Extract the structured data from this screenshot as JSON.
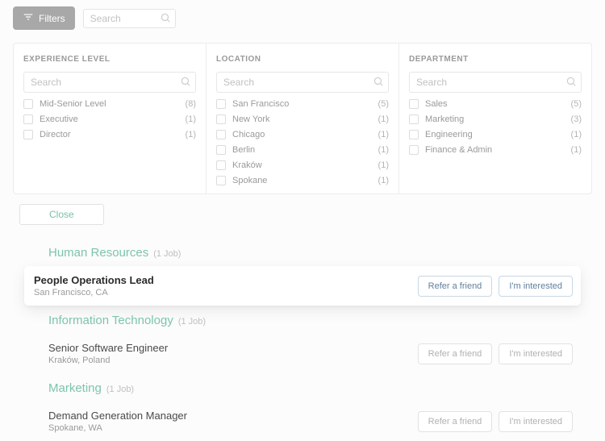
{
  "topbar": {
    "filters_label": "Filters",
    "search_placeholder": "Search"
  },
  "facets": [
    {
      "heading": "EXPERIENCE LEVEL",
      "search_placeholder": "Search",
      "options": [
        {
          "label": "Mid-Senior Level",
          "count": "(8)"
        },
        {
          "label": "Executive",
          "count": "(1)"
        },
        {
          "label": "Director",
          "count": "(1)"
        }
      ]
    },
    {
      "heading": "LOCATION",
      "search_placeholder": "Search",
      "options": [
        {
          "label": "San Francisco",
          "count": "(5)"
        },
        {
          "label": "New York",
          "count": "(1)"
        },
        {
          "label": "Chicago",
          "count": "(1)"
        },
        {
          "label": "Berlin",
          "count": "(1)"
        },
        {
          "label": "Kraków",
          "count": "(1)"
        },
        {
          "label": "Spokane",
          "count": "(1)"
        }
      ]
    },
    {
      "heading": "DEPARTMENT",
      "search_placeholder": "Search",
      "options": [
        {
          "label": "Sales",
          "count": "(5)"
        },
        {
          "label": "Marketing",
          "count": "(3)"
        },
        {
          "label": "Engineering",
          "count": "(1)"
        },
        {
          "label": "Finance & Admin",
          "count": "(1)"
        }
      ]
    }
  ],
  "close_label": "Close",
  "categories": [
    {
      "name": "Human Resources",
      "count_label": "(1 Job)",
      "jobs": [
        {
          "title": "People Operations Lead",
          "location": "San Francisco, CA",
          "highlighted": true
        }
      ]
    },
    {
      "name": "Information Technology",
      "count_label": "(1 Job)",
      "jobs": [
        {
          "title": "Senior Software Engineer",
          "location": "Kraków, Poland",
          "highlighted": false
        }
      ]
    },
    {
      "name": "Marketing",
      "count_label": "(1 Job)",
      "jobs": [
        {
          "title": "Demand Generation Manager",
          "location": "Spokane, WA",
          "highlighted": false
        }
      ]
    }
  ],
  "actions": {
    "refer": "Refer a friend",
    "interested": "I'm interested"
  }
}
